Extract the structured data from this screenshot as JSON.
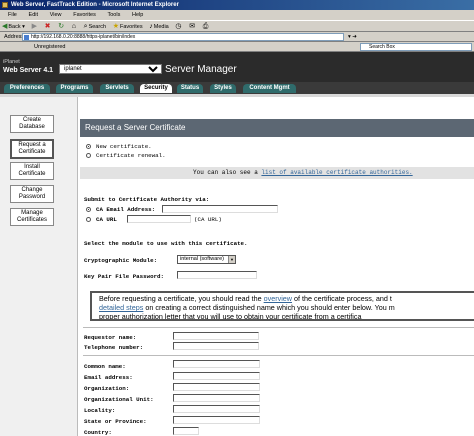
{
  "window": {
    "title": "Web Server, FastTrack Edition - Microsoft Internet Explorer",
    "menu": [
      "File",
      "Edit",
      "View",
      "Favorites",
      "Tools",
      "Help"
    ],
    "toolbar": {
      "back": "Back",
      "search": "Search",
      "favorites": "Favorites",
      "media": "Media"
    },
    "address_label": "Address",
    "address_value": "http://192.168.0.20:8888/https-iplanet/bin/index",
    "links_value": "Unregistered",
    "search_box": "Search Box"
  },
  "header": {
    "brand": "iPlanet",
    "product": "Web Server 4.1",
    "server_select": "iplanet",
    "section_title": "Server Manager"
  },
  "tabs": [
    {
      "label": "Preferences",
      "active": false
    },
    {
      "label": "Programs",
      "active": false
    },
    {
      "label": "Servlets",
      "active": false
    },
    {
      "label": "Security",
      "active": true
    },
    {
      "label": "Status",
      "active": false
    },
    {
      "label": "Styles",
      "active": false
    },
    {
      "label": "Content Mgmt",
      "active": false
    }
  ],
  "leftnav": [
    {
      "line1": "Create",
      "line2": "Database"
    },
    {
      "line1": "Request a",
      "line2": "Certificate"
    },
    {
      "line1": "Install",
      "line2": "Certificate"
    },
    {
      "line1": "Change",
      "line2": "Password"
    },
    {
      "line1": "Manage",
      "line2": "Certificates"
    }
  ],
  "form": {
    "heading": "Request a Server Certificate",
    "radio_new": "New certificate.",
    "radio_renewal": "Certificate renewal.",
    "info_prefix": "You can also see a",
    "info_link": "list of available certificate authorities.",
    "submit_via": "Submit to Certificate Authority via:",
    "ca_email": "CA Email Address:",
    "ca_url": "CA URL",
    "url_placeholder": "(CA URL)",
    "module_prompt": "Select the module to use with this certificate.",
    "crypto_label": "Cryptographic Module:",
    "crypto_value": "internal (software)",
    "keypair_label": "Key Pair File Password:",
    "notice_1a": "Before requesting a certificate, you should read the",
    "notice_1link": "overview",
    "notice_1b": "of the certificate process, and t",
    "notice_2link": "detailed steps",
    "notice_2b": "on creating a correct distinguished name which you should enter below. You m",
    "notice_3": "proper authorization letter that you will use to obtain your certificate from a certifica",
    "fields": {
      "requestor": "Requestor name:",
      "telephone": "Telephone number:",
      "common": "Common name:",
      "email": "Email address:",
      "org": "Organization:",
      "org_unit": "Organizational Unit:",
      "locality": "Locality:",
      "state": "State or Province:",
      "country": "Country:"
    }
  }
}
